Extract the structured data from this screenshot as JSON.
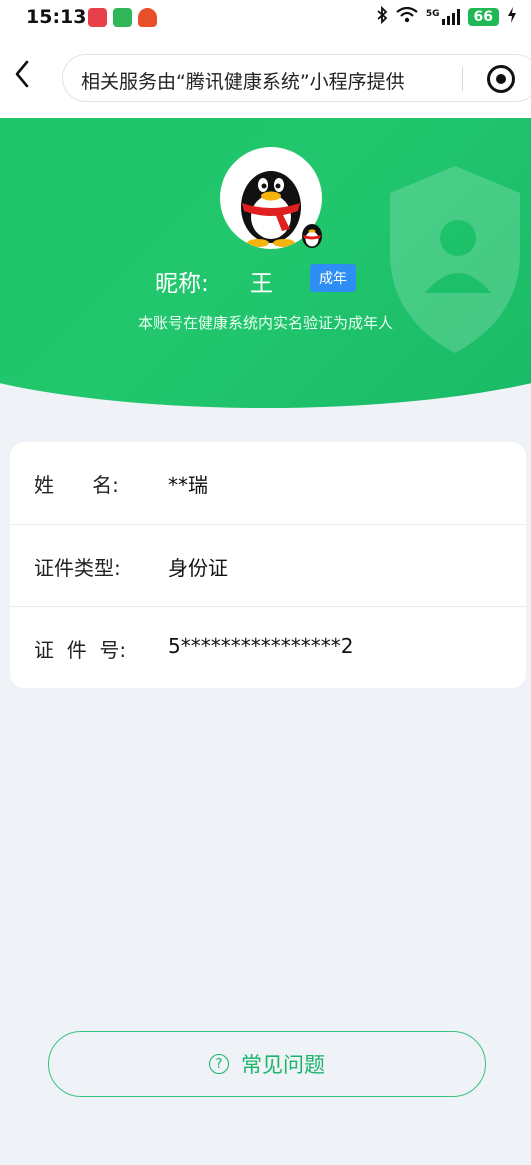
{
  "status_bar": {
    "time": "15:13",
    "network": "5G",
    "battery": "66"
  },
  "nav": {
    "notice": "相关服务由“腾讯健康系统”小程序提供"
  },
  "profile": {
    "nickname_label": "昵称:",
    "nickname_value": "王",
    "badge": "成年",
    "verify_text": "本账号在健康系统内实名验证为成年人"
  },
  "info": {
    "rows": [
      {
        "label": "姓      名:",
        "value": "**瑞"
      },
      {
        "label": "证件类型:",
        "value": "身份证"
      },
      {
        "label": "证  件  号:",
        "value": "5****************2"
      }
    ]
  },
  "faq": {
    "label": "常见问题",
    "icon_glyph": "?"
  },
  "colors": {
    "brand_green": "#1dc468",
    "badge_blue": "#2e8ef3",
    "faq_green": "#1bb46a",
    "page_bg": "#eff2f6"
  }
}
